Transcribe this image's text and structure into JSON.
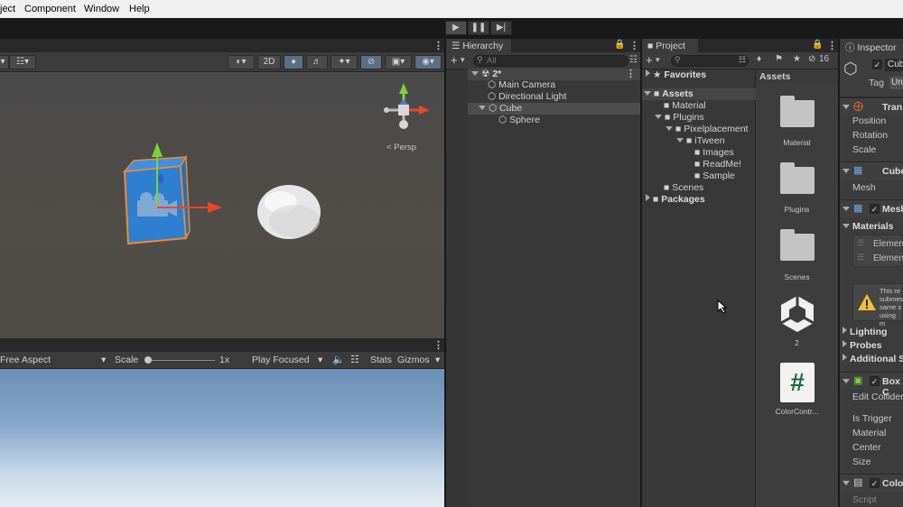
{
  "menu": [
    "ject",
    "Component",
    "Window",
    "Help"
  ],
  "scene_toolbar": {
    "mode_2d": "2D"
  },
  "scene": {
    "persp_label": "< Persp"
  },
  "game_toolbar": {
    "aspect": "Free Aspect",
    "scale_label": "Scale",
    "scale_value": "1x",
    "play_focused": "Play Focused",
    "stats": "Stats",
    "gizmos": "Gizmos"
  },
  "hierarchy": {
    "tab": "Hierarchy",
    "search_placeholder": "All",
    "scene_name": "2*",
    "items": [
      "Main Camera",
      "Directional Light",
      "Cube",
      "Sphere"
    ]
  },
  "project": {
    "tab": "Project",
    "count": "16",
    "favorites": "Favorites",
    "assets_root": "Assets",
    "tree": [
      "Material",
      "Plugins",
      "Pixelplacement",
      "iTween",
      "Images",
      "ReadMe!",
      "Sample",
      "Scenes"
    ],
    "packages": "Packages",
    "grid_header": "Assets",
    "grid_items": [
      "Material",
      "Plugins",
      "Scenes",
      "2",
      "ColorContr..."
    ]
  },
  "inspector": {
    "tab": "Inspector",
    "object_name": "Cub",
    "tag_label": "Tag",
    "tag_value": "Un",
    "transform": "Tran",
    "position": "Position",
    "rotation": "Rotation",
    "scale": "Scale",
    "mesh_filter": "Cube",
    "mesh": "Mesh",
    "mesh_renderer": "Mesh",
    "materials": "Materials",
    "element0": "Elemen",
    "element1": "Elemen",
    "warning_lines": [
      "This re",
      "submes",
      "same s",
      "using m"
    ],
    "lighting": "Lighting",
    "probes": "Probes",
    "additional": "Additional S",
    "box_collider": "Box C",
    "edit_collider": "Edit Collider",
    "is_trigger": "Is Trigger",
    "material": "Material",
    "center": "Center",
    "size": "Size",
    "color_script": "Colo",
    "script": "Script"
  },
  "colors": {
    "selection": "#2c5d87",
    "cube_blue": "#2f7fd0",
    "cube_outline": "#f08a30",
    "gizmo_green": "#7bd23a",
    "gizmo_red": "#e8472a"
  }
}
